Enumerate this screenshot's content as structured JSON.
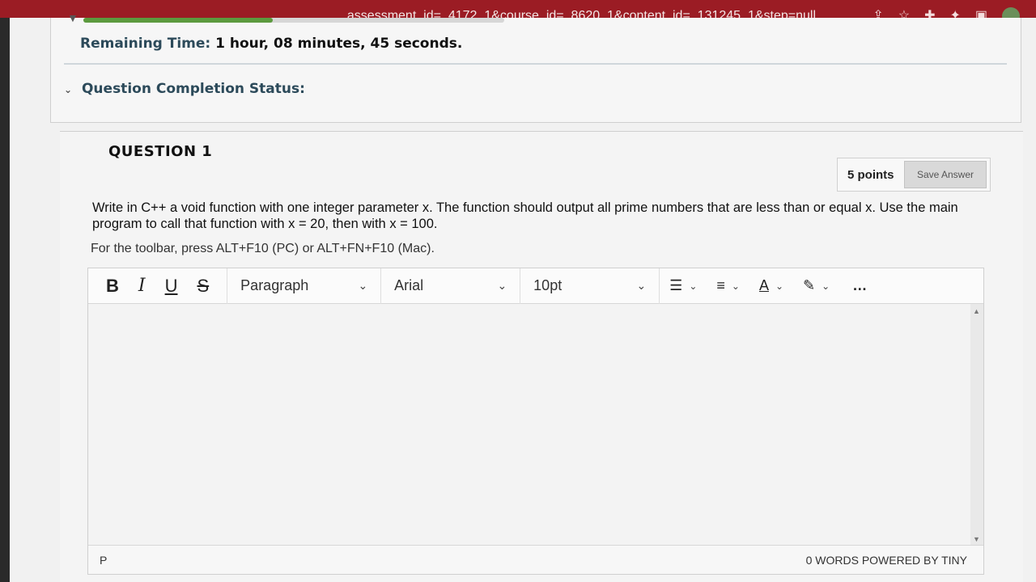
{
  "browser": {
    "url": "_assessment_id=_4172_1&course_id=_8620_1&content_id=_131245_1&step=null",
    "icons": [
      "share-icon",
      "star-icon",
      "extension-icon",
      "puzzle-icon",
      "window-icon",
      "profile-avatar"
    ]
  },
  "timer": {
    "label": "Remaining Time:",
    "value": "1 hour, 08 minutes, 45 seconds.",
    "progress_fraction": 0.45,
    "accent_color": "#5c9a3e"
  },
  "completion": {
    "label": "Question Completion Status:"
  },
  "question": {
    "title": "QUESTION 1",
    "points": "5 points",
    "save_label": "Save Answer",
    "text": "Write in C++ a void function with one integer parameter x. The function should output all prime numbers that are less than or equal x. Use the main program to call that function with x = 20, then with x = 100.",
    "toolbar_hint": "For the toolbar, press ALT+F10 (PC) or ALT+FN+F10 (Mac)."
  },
  "editor": {
    "bold": "B",
    "italic": "I",
    "underline": "U",
    "strike": "S",
    "block_format": "Paragraph",
    "font_family": "Arial",
    "font_size": "10pt",
    "more": "…",
    "word_count": "0 WORDS",
    "powered_by": "POWERED BY TINY",
    "path": "P"
  }
}
